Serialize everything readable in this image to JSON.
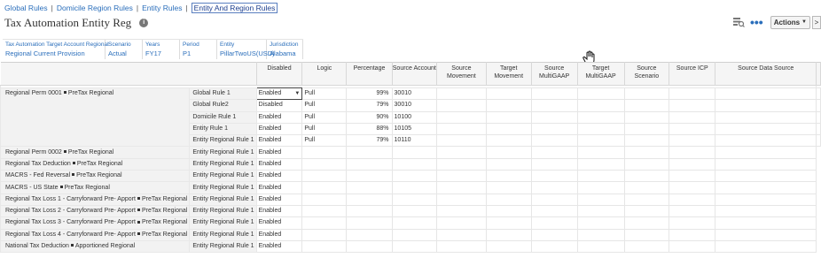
{
  "breadcrumbs": [
    "Global Rules",
    "Domicile Region Rules",
    "Entity Rules",
    "Entity And Region Rules"
  ],
  "title": "Tax Automation Entity Reg",
  "toolbar": {
    "more": "•••",
    "actions_label": "Actions",
    "next_label": ">"
  },
  "pov": [
    {
      "label": "Tax Automation Target Account Regional",
      "value": "Regional Current Provision"
    },
    {
      "label": "Scenario",
      "value": "Actual"
    },
    {
      "label": "Years",
      "value": "FY17"
    },
    {
      "label": "Period",
      "value": "P1"
    },
    {
      "label": "Entity",
      "value": "PillarTwoUS(USD)"
    },
    {
      "label": "Jurisdiction",
      "value": "Alabama"
    }
  ],
  "columns": [
    "Disabled",
    "Logic",
    "Percentage",
    "Source Account",
    "Source Movement",
    "Target Movement",
    "Source MultiGAAP",
    "Target MultiGAAP",
    "Source Scenario",
    "Source ICP",
    "Source Data Source"
  ],
  "rows": [
    {
      "group": [
        "Regional Perm 0001",
        "PreTax Regional"
      ],
      "rule": "Global Rule 1",
      "disabled": "Enabled",
      "logic": "Pull",
      "percentage": "99%",
      "source_account": "30010"
    },
    {
      "group": null,
      "rule": "Global Rule2",
      "disabled": "Disabled",
      "logic": "Pull",
      "percentage": "79%",
      "source_account": "30010"
    },
    {
      "group": null,
      "rule": "Domicile Rule 1",
      "disabled": "Enabled",
      "logic": "Pull",
      "percentage": "90%",
      "source_account": "10100"
    },
    {
      "group": null,
      "rule": "Entity Rule 1",
      "disabled": "Enabled",
      "logic": "Pull",
      "percentage": "88%",
      "source_account": "10105"
    },
    {
      "group": null,
      "rule": "Entity Regional Rule 1",
      "disabled": "Enabled",
      "logic": "Pull",
      "percentage": "79%",
      "source_account": "10110"
    },
    {
      "group": [
        "Regional Perm 0002",
        "PreTax Regional"
      ],
      "rule": "Entity Regional Rule 1",
      "disabled": "Enabled"
    },
    {
      "group": [
        "Regional Tax Deduction",
        "PreTax Regional"
      ],
      "rule": "Entity Regional Rule 1",
      "disabled": "Enabled"
    },
    {
      "group": [
        "MACRS - Fed Reversal",
        "PreTax Regional"
      ],
      "rule": "Entity Regional Rule 1",
      "disabled": "Enabled"
    },
    {
      "group": [
        "MACRS - US State",
        "PreTax Regional"
      ],
      "rule": "Entity Regional Rule 1",
      "disabled": "Enabled"
    },
    {
      "group": [
        "Regional Tax Loss 1 - Carryforward Pre- Apport",
        "PreTax Regional"
      ],
      "rule": "Entity Regional Rule 1",
      "disabled": "Enabled"
    },
    {
      "group": [
        "Regional Tax Loss 2 - Carryforward Pre- Apport",
        "PreTax Regional"
      ],
      "rule": "Entity Regional Rule 1",
      "disabled": "Enabled"
    },
    {
      "group": [
        "Regional Tax Loss 3 - Carryforward Pre- Apport",
        "PreTax Regional"
      ],
      "rule": "Entity Regional Rule 1",
      "disabled": "Enabled"
    },
    {
      "group": [
        "Regional Tax Loss 4 - Carryforward Pre- Apport",
        "PreTax Regional"
      ],
      "rule": "Entity Regional Rule 1",
      "disabled": "Enabled"
    },
    {
      "group": [
        "National Tax Deduction",
        "Apportioned Regional"
      ],
      "rule": "Entity Regional Rule 1",
      "disabled": "Enabled"
    }
  ]
}
